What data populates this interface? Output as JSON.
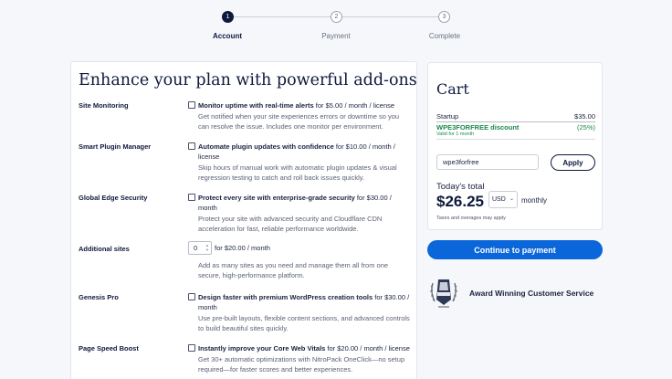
{
  "stepper": {
    "steps": [
      {
        "number": "1",
        "label": "Account",
        "active": true
      },
      {
        "number": "2",
        "label": "Payment",
        "active": false
      },
      {
        "number": "3",
        "label": "Complete",
        "active": false
      }
    ]
  },
  "addons": {
    "title": "Enhance your plan with powerful add-ons",
    "items": [
      {
        "name": "Site Monitoring",
        "head_bold": "Monitor uptime with real-time alerts",
        "head_rest": " for $5.00 / month / license",
        "desc": "Get notified when your site experiences errors or downtime so you can resolve the issue. Includes one monitor per environment.",
        "checked": false
      },
      {
        "name": "Smart Plugin Manager",
        "head_bold": "Automate plugin updates with confidence",
        "head_rest": " for $10.00 / month / license",
        "desc": "Skip hours of manual work with automatic plugin updates & visual regression testing to catch and roll back issues quickly.",
        "checked": false
      },
      {
        "name": "Global Edge Security",
        "head_bold": "Protect every site with enterprise-grade security",
        "head_rest": " for $30.00 / month",
        "desc": "Protect your site with advanced security and Cloudflare CDN acceleration for fast, reliable performance worldwide.",
        "checked": false
      },
      {
        "name": "Additional sites",
        "quantity": "0",
        "qty_label": "for $20.00 / month",
        "desc": "Add as many sites as you need and manage them all from one secure, high-performance platform."
      },
      {
        "name": "Genesis Pro",
        "head_bold": "Design faster with premium WordPress creation tools",
        "head_rest": " for $30.00 / month",
        "desc": "Use pre-built layouts, flexible content sections, and advanced controls to build beautiful sites quickly.",
        "checked": false
      },
      {
        "name": "Page Speed Boost",
        "head_bold": "Instantly improve your Core Web Vitals",
        "head_rest": " for $20.00 / month / license",
        "desc": "Get 30+ automatic optimizations with NitroPack OneClick—no setup required—for faster scores and better experiences.",
        "checked": false
      }
    ]
  },
  "cart": {
    "title": "Cart",
    "plan_name": "Startup",
    "plan_price": "$35.00",
    "discount_name": "WPE3FORFREE discount",
    "discount_value": "(25%)",
    "discount_validity": "Valid for 1 month",
    "promo_value": "wpe3forfree",
    "apply_label": "Apply",
    "today_label": "Today's total",
    "today_price": "$26.25",
    "currency": "USD",
    "period": "monthly",
    "taxes_note": "Taxes and overages may apply"
  },
  "continue_label": "Continue to payment",
  "award": {
    "text": "Award Winning Customer Service"
  },
  "colors": {
    "primary": "#0a66d9",
    "navy": "#0e1a3d",
    "discount": "#1a8a4a"
  }
}
